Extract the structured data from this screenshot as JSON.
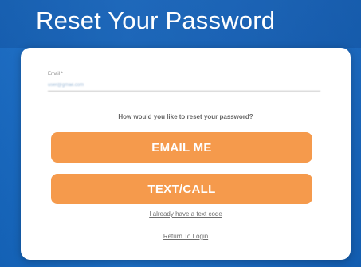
{
  "page": {
    "title": "Reset Your Password"
  },
  "form": {
    "email_label": "Email *",
    "email_value": "user@gmail.com",
    "prompt": "How would you like to reset your password?",
    "email_button": "EMAIL ME",
    "text_button": "TEXT/CALL",
    "code_link": "I already have a text code",
    "login_link": "Return To Login"
  },
  "colors": {
    "background": "#1a6cc4",
    "card": "#ffffff",
    "button": "#f59a4c",
    "text": "#676767"
  }
}
